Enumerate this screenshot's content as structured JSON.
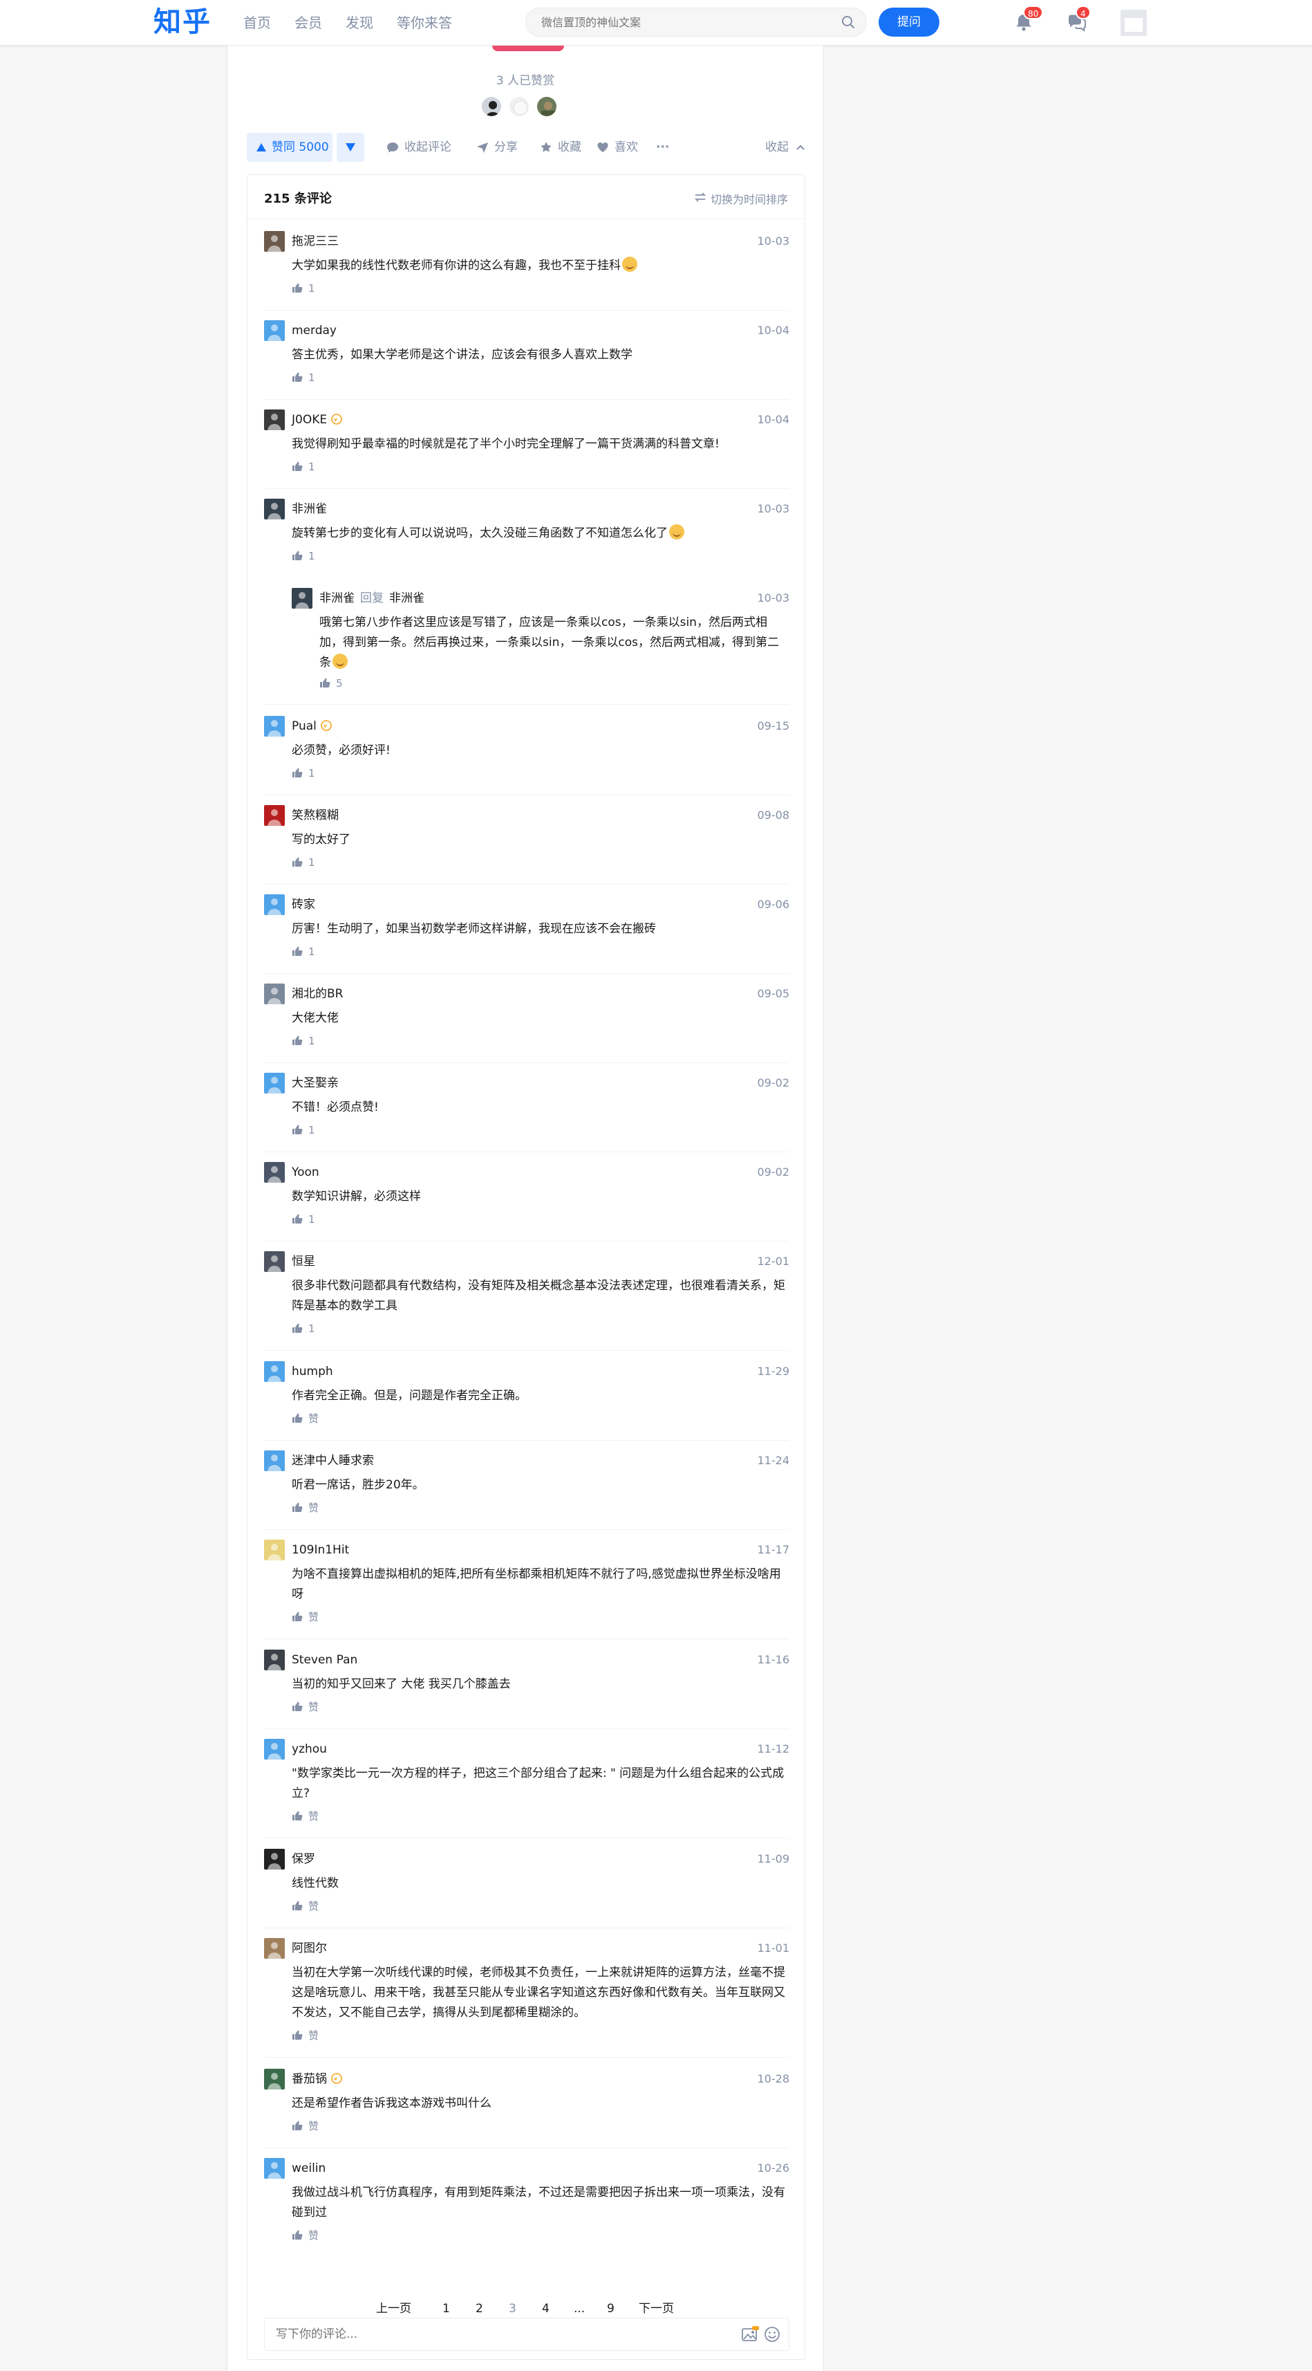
{
  "header": {
    "logo": "知乎",
    "nav": [
      "首页",
      "会员",
      "发现",
      "等你来答"
    ],
    "search_placeholder": "微信置顶的神仙文案",
    "ask_label": "提问",
    "notifications_badge": "80",
    "messages_badge": "4"
  },
  "appreciate": {
    "count_text": "3 人已赞赏"
  },
  "actions": {
    "vote_label": "赞同 5000",
    "collapse_comments": "收起评论",
    "share": "分享",
    "favorite": "收藏",
    "like": "喜欢",
    "more": "···",
    "collapse": "收起"
  },
  "comments": {
    "count_label": "215 条评论",
    "sort_label": "切换为时间排序",
    "items": [
      {
        "author": "拖泥三三",
        "date": "10-03",
        "text": "大学如果我的线性代数老师有你讲的这么有趣，我也不至于挂科",
        "likes": "1",
        "emoji": true
      },
      {
        "author": "merday",
        "date": "10-04",
        "text": "答主优秀，如果大学老师是这个讲法，应该会有很多人喜欢上数学",
        "likes": "1"
      },
      {
        "author": "J0OKE",
        "date": "10-04",
        "text": "我觉得刷知乎最幸福的时候就是花了半个小时完全理解了一篇干货满满的科普文章!",
        "likes": "1",
        "vip": true
      },
      {
        "author": "非洲雀",
        "date": "10-03",
        "text": "旋转第七步的变化有人可以说说吗，太久没碰三角函数了不知道怎么化了",
        "likes": "1",
        "emoji": true
      },
      {
        "author": "Pual",
        "date": "09-15",
        "text": "必须赞，必须好评!",
        "likes": "1",
        "vip": true
      },
      {
        "author": "笑熬糨糊",
        "date": "09-08",
        "text": "写的太好了",
        "likes": "1"
      },
      {
        "author": "砖家",
        "date": "09-06",
        "text": "厉害！生动明了，如果当初数学老师这样讲解，我现在应该不会在搬砖",
        "likes": "1"
      },
      {
        "author": "湘北的BR",
        "date": "09-05",
        "text": "大佬大佬",
        "likes": "1"
      },
      {
        "author": "大圣娶亲",
        "date": "09-02",
        "text": "不错！必须点赞!",
        "likes": "1"
      },
      {
        "author": "Yoon",
        "date": "09-02",
        "text": "数学知识讲解，必须这样",
        "likes": "1"
      },
      {
        "author": "恒星",
        "date": "12-01",
        "text": "很多非代数问题都具有代数结构，没有矩阵及相关概念基本没法表述定理，也很难看清关系，矩阵是基本的数学工具",
        "likes": "1"
      },
      {
        "author": "humph",
        "date": "11-29",
        "text": "作者完全正确。但是，问题是作者完全正确。",
        "likes": "赞"
      },
      {
        "author": "迷津中人睡求索",
        "date": "11-24",
        "text": "听君一席话，胜步20年。",
        "likes": "赞"
      },
      {
        "author": "109In1Hit",
        "date": "11-17",
        "text": "为啥不直接算出虚拟相机的矩阵,把所有坐标都乘相机矩阵不就行了吗,感觉虚拟世界坐标没啥用呀",
        "likes": "赞"
      },
      {
        "author": "Steven Pan",
        "date": "11-16",
        "text": "当初的知乎又回来了 大佬 我买几个膝盖去",
        "likes": "赞"
      },
      {
        "author": "yzhou",
        "date": "11-12",
        "text": "\"数学家类比一元一次方程的样子，把这三个部分组合了起来: \" 问题是为什么组合起来的公式成立?",
        "likes": "赞"
      },
      {
        "author": "保罗",
        "date": "11-09",
        "text": "线性代数",
        "likes": "赞"
      },
      {
        "author": "阿图尔",
        "date": "11-01",
        "text": "当初在大学第一次听线代课的时候，老师极其不负责任，一上来就讲矩阵的运算方法，丝毫不提这是啥玩意儿、用来干啥，我甚至只能从专业课名字知道这东西好像和代数有关。当年互联网又不发达，又不能自己去学，搞得从头到尾都稀里糊涂的。",
        "likes": "赞"
      },
      {
        "author": "番茄锅",
        "date": "10-28",
        "text": "还是希望作者告诉我这本游戏书叫什么",
        "likes": "赞",
        "vip": true
      },
      {
        "author": "weilin",
        "date": "10-26",
        "text": "我做过战斗机飞行仿真程序，有用到矩阵乘法，不过还是需要把因子拆出来一项一项乘法，没有碰到过",
        "likes": "赞"
      }
    ],
    "reply": {
      "author": "非洲雀",
      "reply_word": "回复",
      "reply_to": "非洲雀",
      "date": "10-03",
      "text": "哦第七第八步作者这里应该是写错了，应该是一条乘以cos，一条乘以sin，然后两式相加，得到第一条。然后再换过来，一条乘以sin，一条乘以cos，然后两式相减，得到第二条",
      "likes": "5"
    }
  },
  "pagination": {
    "prev": "上一页",
    "pages": [
      "1",
      "2",
      "3",
      "4",
      "...",
      "9"
    ],
    "next": "下一页"
  },
  "input": {
    "placeholder": "写下你的评论..."
  },
  "colors": {
    "brand": "#1772f6",
    "muted": "#8590a6",
    "badge": "#f1403c",
    "appreciate": "#ea4c6e"
  }
}
